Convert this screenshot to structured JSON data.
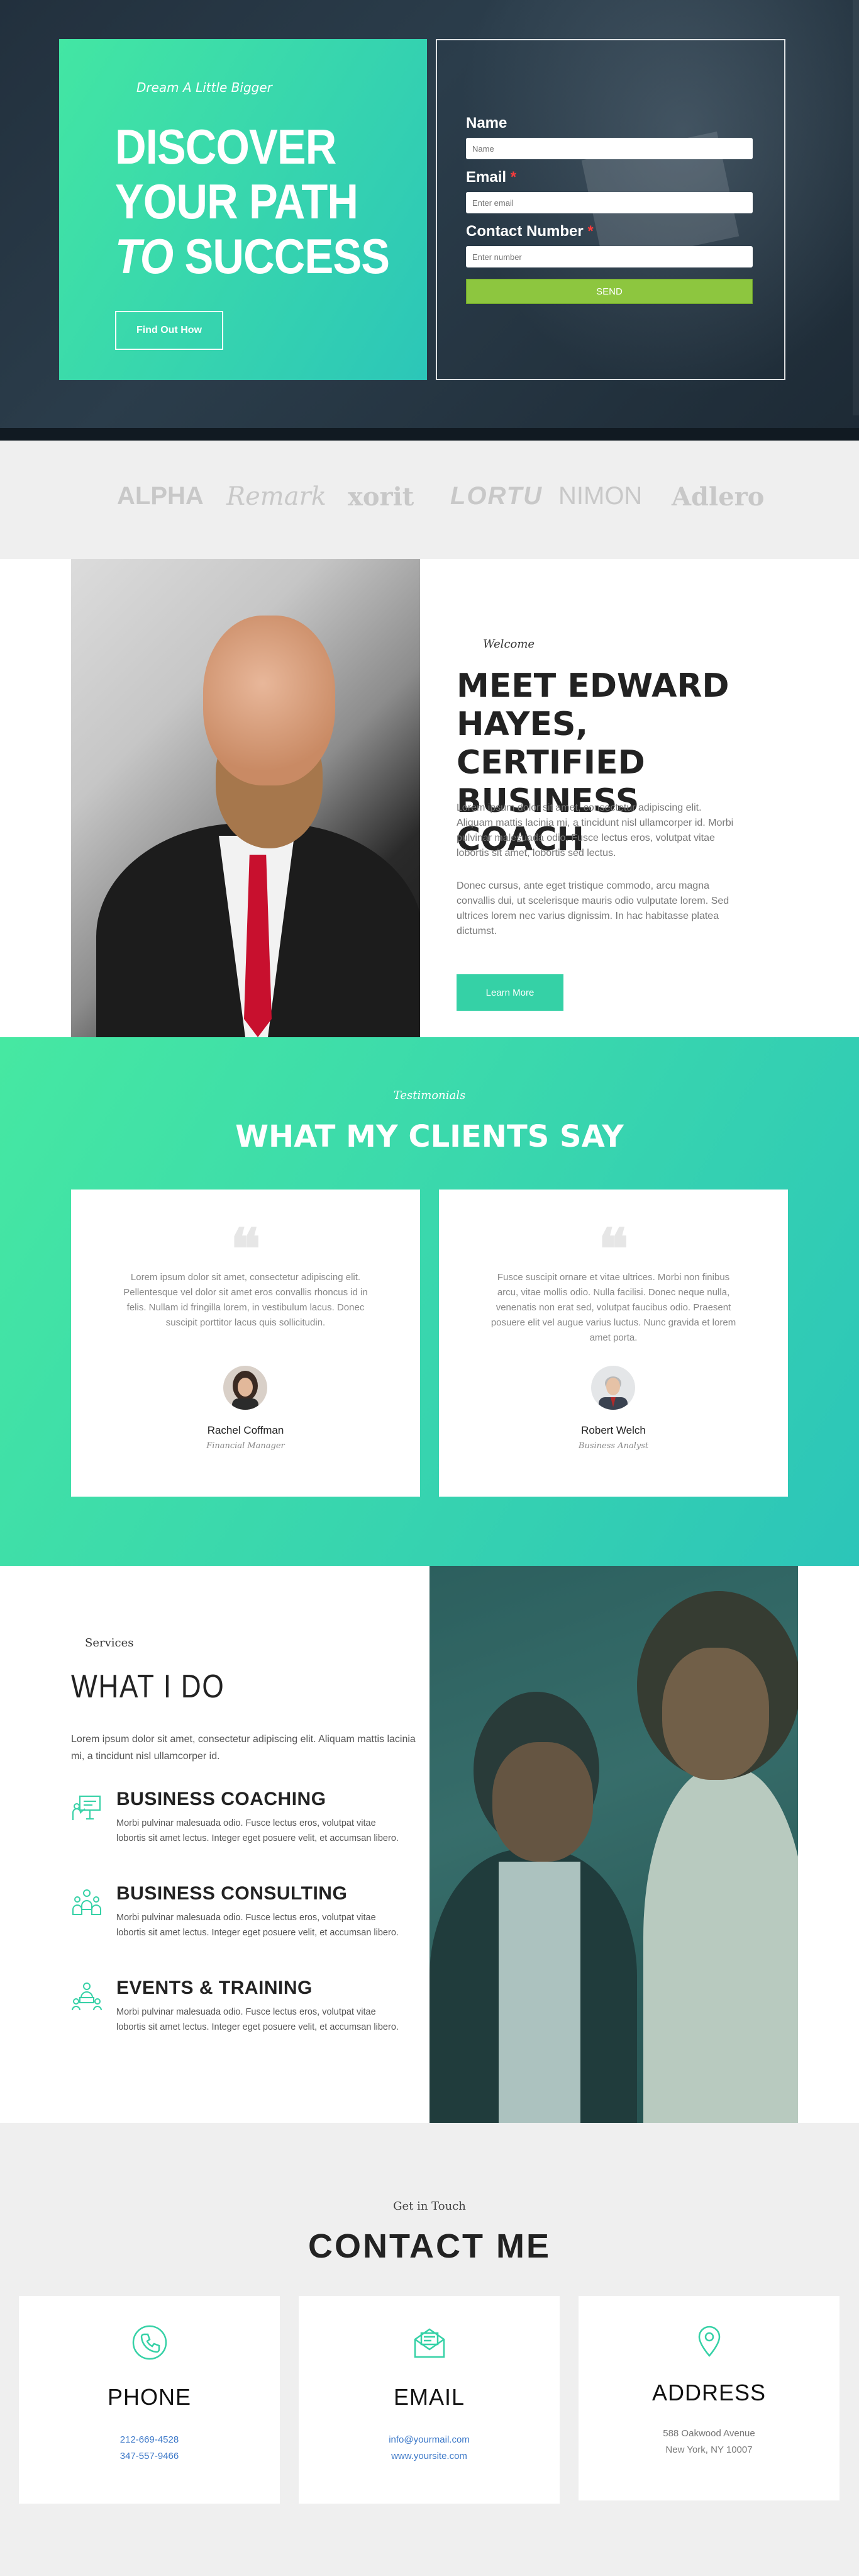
{
  "hero": {
    "tagline": "Dream A Little Bigger",
    "title_line1": "DISCOVER",
    "title_line2": "YOUR PATH",
    "title_line3_italic": "TO",
    "title_line3_rest": "SUCCESS",
    "cta": "Find Out How"
  },
  "form": {
    "name_label": "Name",
    "name_placeholder": "Name",
    "email_label": "Email",
    "email_placeholder": "Enter email",
    "contact_label": "Contact Number",
    "contact_placeholder": "Enter number",
    "required_mark": "*",
    "send": "SEND"
  },
  "logos": [
    "ALPHA",
    "Remark",
    "xorit",
    "LORTU",
    "NIMON",
    "Adlero"
  ],
  "about": {
    "welcome": "Welcome",
    "title": "MEET EDWARD HAYES, CERTIFIED BUSINESS COACH",
    "p1": "Lorem ipsum dolor sit amet, consectetur adipiscing elit. Aliquam mattis lacinia mi, a tincidunt nisl ullamcorper id. Morbi pulvinar malesuada odio. Fusce lectus eros, volutpat vitae lobortis sit amet, lobortis sed lectus.",
    "p2": "Donec cursus, ante eget tristique commodo, arcu magna convallis dui, ut scelerisque mauris odio vulputate lorem. Sed ultrices lorem nec varius dignissim. In hac habitasse platea dictumst.",
    "button": "Learn More"
  },
  "testimonials": {
    "tag": "Testimonials",
    "title": "WHAT MY CLIENTS SAY",
    "quote_mark": "❝",
    "items": [
      {
        "text": "Lorem ipsum dolor sit amet, consectetur adipiscing elit. Pellentesque vel dolor sit amet eros convallis rhoncus id in felis. Nullam id fringilla lorem, in vestibulum lacus. Donec suscipit porttitor lacus quis sollicitudin.",
        "name": "Rachel Coffman",
        "role": "Financial Manager"
      },
      {
        "text": "Fusce suscipit ornare et vitae ultrices. Morbi non finibus arcu, vitae mollis odio. Nulla facilisi. Donec neque nulla, venenatis non erat sed, volutpat faucibus odio. Praesent posuere elit vel augue varius luctus. Nunc gravida et lorem amet porta.",
        "name": "Robert Welch",
        "role": "Business Analyst"
      }
    ]
  },
  "services": {
    "tag": "Services",
    "title": "WHAT I DO",
    "intro": "Lorem ipsum dolor sit amet, consectetur adipiscing elit. Aliquam mattis lacinia mi, a tincidunt nisl ullamcorper id.",
    "items": [
      {
        "title": "BUSINESS COACHING",
        "icon": "presentation-icon",
        "text": "Morbi pulvinar malesuada odio. Fusce lectus eros, volutpat vitae lobortis sit amet lectus. Integer eget posuere velit, et accumsan libero."
      },
      {
        "title": "BUSINESS CONSULTING",
        "icon": "team-icon",
        "text": "Morbi pulvinar malesuada odio. Fusce lectus eros, volutpat vitae lobortis sit amet lectus. Integer eget posuere velit, et accumsan libero."
      },
      {
        "title": "EVENTS & TRAINING",
        "icon": "training-icon",
        "text": "Morbi pulvinar malesuada odio. Fusce lectus eros, volutpat vitae lobortis sit amet lectus. Integer eget posuere velit, et accumsan libero."
      }
    ]
  },
  "contact": {
    "tag": "Get in Touch",
    "title": "CONTACT ME",
    "phone": {
      "title": "PHONE",
      "icon": "phone-icon",
      "line1": "212-669-4528",
      "line2": "347-557-9466"
    },
    "email": {
      "title": "EMAIL",
      "icon": "email-icon",
      "line1": "info@yourmail.com",
      "line2": "www.yoursite.com"
    },
    "address": {
      "title": "ADDRESS",
      "icon": "location-pin-icon",
      "line1": "588 Oakwood Avenue",
      "line2": "New York, NY 10007"
    }
  },
  "colors": {
    "accent_green": "#43e6a3",
    "accent_teal": "#2cc6b8",
    "send_green": "#8dc63f",
    "link_blue": "#3c78c8"
  }
}
